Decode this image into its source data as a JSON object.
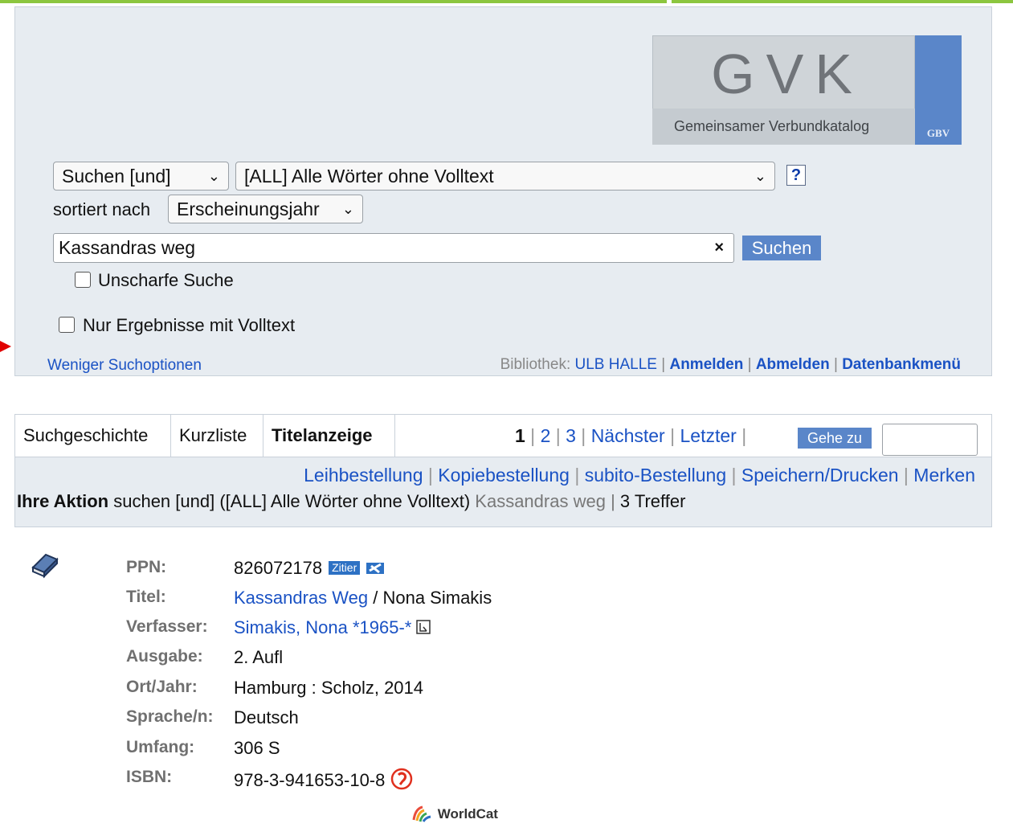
{
  "colors": {
    "accent": "#5a86c9",
    "link": "#1a52c4",
    "panel": "#e7ecf1",
    "topbar": "#8cc63f"
  },
  "logo": {
    "title": "GVK",
    "subtitle": "Gemeinsamer Verbundkatalog",
    "badge": "GBV"
  },
  "search": {
    "operator": "Suchen [und]",
    "field": "[ALL] Alle Wörter ohne Volltext",
    "help": "?",
    "sort_label": "sortiert nach",
    "sort_value": "Erscheinungsjahr",
    "query": "Kassandras weg",
    "clear": "×",
    "submit": "Suchen",
    "fuzzy_label": "Unscharfe Suche",
    "fulltext_label": "Nur Ergebnisse mit Volltext",
    "fewer_options": "Weniger Suchoptionen",
    "library_label": "Bibliothek:",
    "library_name": "ULB HALLE",
    "login": "Anmelden",
    "logout": "Abmelden",
    "db_menu": "Datenbankmenü"
  },
  "tabs": [
    "Suchgeschichte",
    "Kurzliste",
    "Titelanzeige"
  ],
  "pager": {
    "current": "1",
    "p2": "2",
    "p3": "3",
    "next": "Nächster",
    "last": "Letzter",
    "goto": "Gehe zu"
  },
  "actions": {
    "loan": "Leihbestellung",
    "copy": "Kopiebestellung",
    "subito": "subito-Bestellung",
    "save": "Speichern/Drucken",
    "mark": "Merken"
  },
  "your_action": {
    "label": "Ihre Aktion",
    "op": "suchen [und]",
    "field": "([ALL] Alle Wörter ohne Volltext)",
    "query": "Kassandras weg",
    "hits": "3 Treffer"
  },
  "record": {
    "ppn_label": "PPN:",
    "ppn": "826072178",
    "zitier": "Zitier",
    "title_label": "Titel:",
    "title": "Kassandras Weg",
    "title_rest": " / Nona Simakis",
    "author_label": "Verfasser:",
    "author": "Simakis, Nona *1965-*",
    "edition_label": "Ausgabe:",
    "edition": "2. Aufl",
    "place_label": "Ort/Jahr:",
    "place": "Hamburg : Scholz, 2014",
    "lang_label": "Sprache/n:",
    "lang": "Deutsch",
    "extent_label": "Umfang:",
    "extent": "306 S",
    "isbn_label": "ISBN:",
    "isbn": "978-3-941653-10-8",
    "worldcat": "WorldCat"
  }
}
